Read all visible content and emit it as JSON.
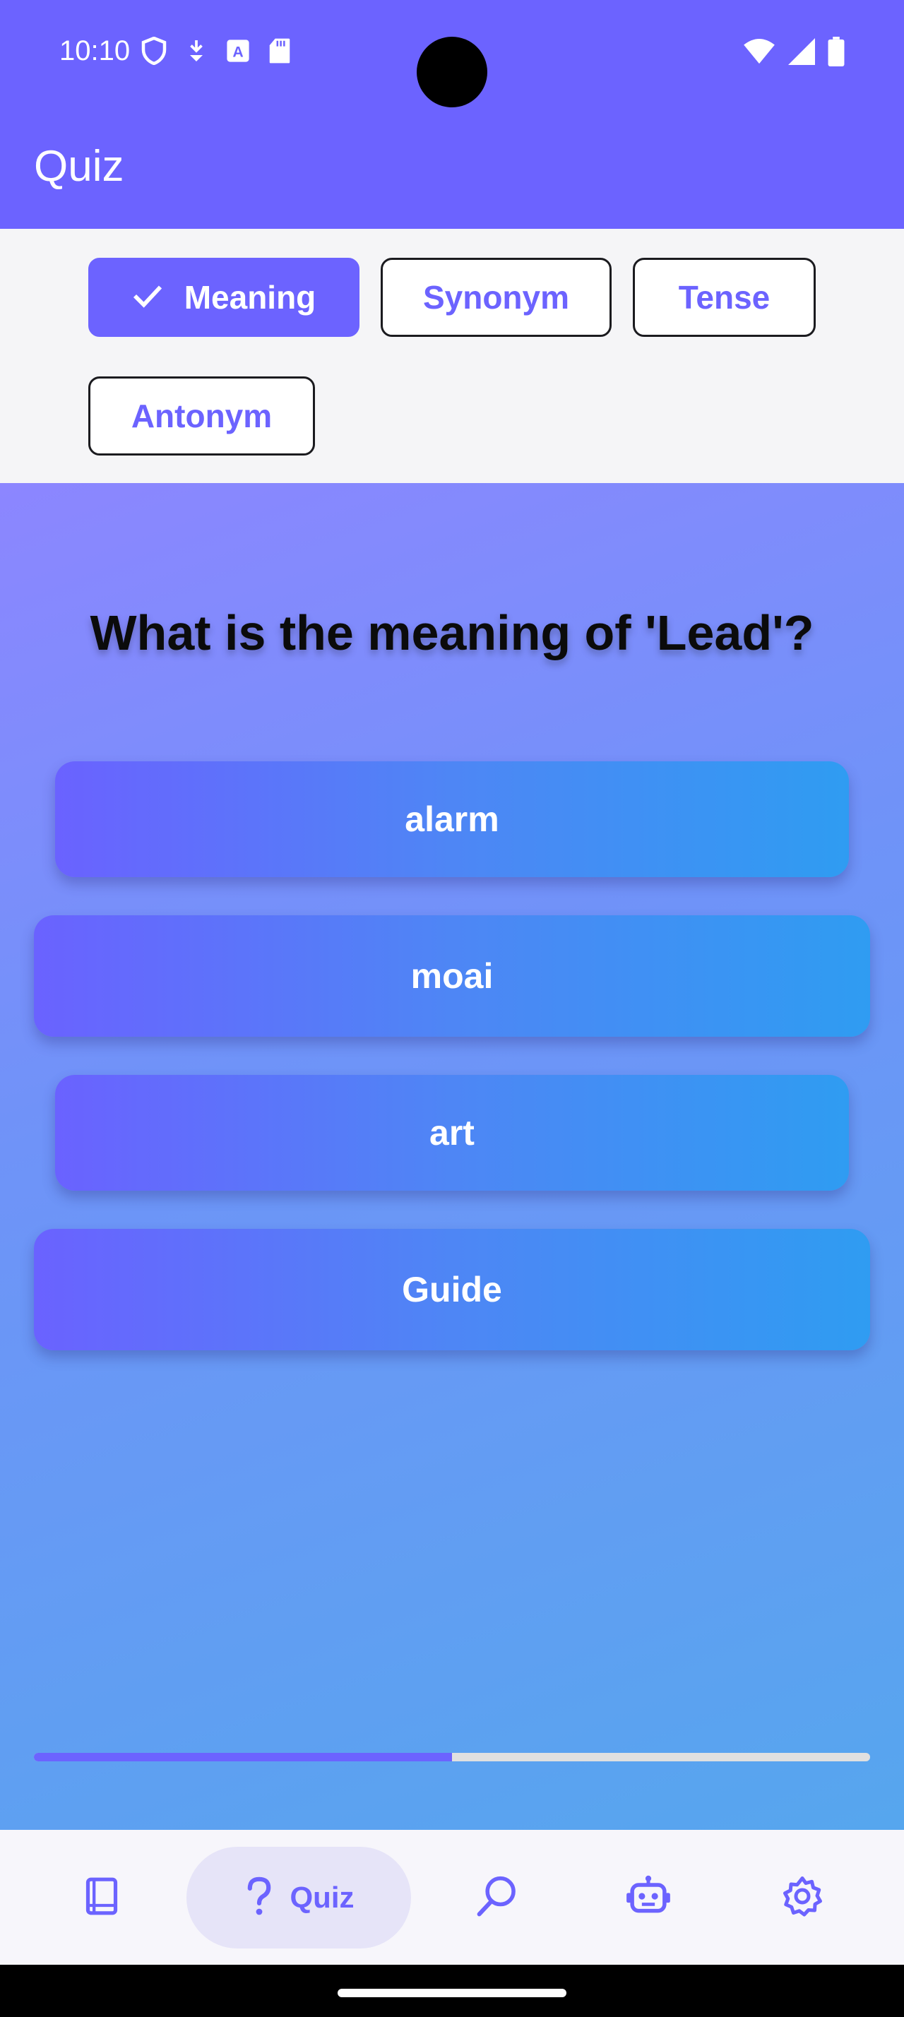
{
  "status_bar": {
    "time": "10:10",
    "left_icons": [
      "shield-icon",
      "download-icon",
      "text-icon",
      "sd-card-icon"
    ],
    "right_icons": [
      "wifi-icon",
      "signal-icon",
      "battery-icon"
    ]
  },
  "app_bar": {
    "title": "Quiz"
  },
  "chips": [
    {
      "label": "Meaning",
      "selected": true
    },
    {
      "label": "Synonym",
      "selected": false
    },
    {
      "label": "Tense",
      "selected": false
    },
    {
      "label": "Antonym",
      "selected": false
    }
  ],
  "quiz": {
    "question": "What is the meaning of 'Lead'?",
    "answers": [
      "alarm",
      "moai",
      "art",
      "Guide"
    ],
    "progress_percent": 50
  },
  "bottom_nav": {
    "items": [
      {
        "icon": "book-icon",
        "label": ""
      },
      {
        "icon": "help-icon",
        "label": "Quiz",
        "active": true
      },
      {
        "icon": "search-icon",
        "label": ""
      },
      {
        "icon": "robot-icon",
        "label": ""
      },
      {
        "icon": "settings-icon",
        "label": ""
      }
    ]
  },
  "colors": {
    "primary": "#6C63FF",
    "gradient_end": "#2F9CF2",
    "background": "#F5F5F7"
  }
}
